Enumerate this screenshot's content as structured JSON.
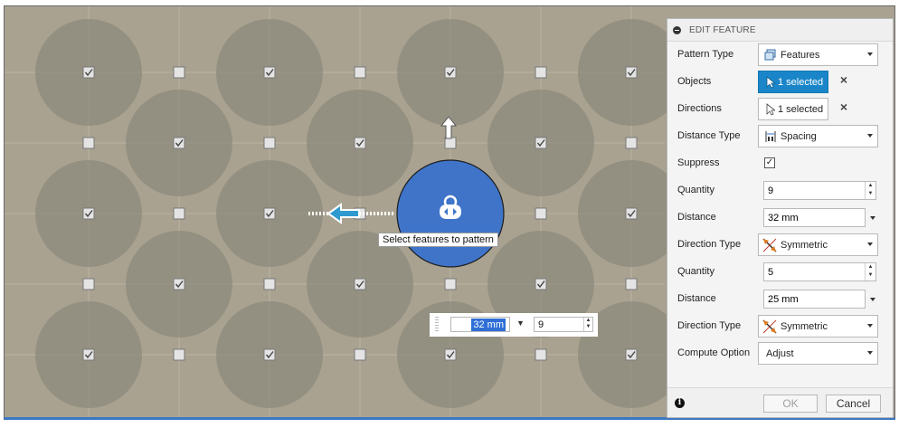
{
  "viewport": {
    "tooltip": "Select features to pattern",
    "inline_distance": "32 mm",
    "inline_quantity": "9"
  },
  "panel": {
    "title": "EDIT FEATURE",
    "rows": {
      "pattern_type": {
        "label": "Pattern Type",
        "value": "Features"
      },
      "objects": {
        "label": "Objects",
        "value": "1 selected"
      },
      "directions": {
        "label": "Directions",
        "value": "1 selected"
      },
      "distance_type": {
        "label": "Distance Type",
        "value": "Spacing"
      },
      "suppress": {
        "label": "Suppress",
        "checked": true
      },
      "quantity1": {
        "label": "Quantity",
        "value": "9"
      },
      "distance1": {
        "label": "Distance",
        "value": "32 mm"
      },
      "direction_type1": {
        "label": "Direction Type",
        "value": "Symmetric"
      },
      "quantity2": {
        "label": "Quantity",
        "value": "5"
      },
      "distance2": {
        "label": "Distance",
        "value": "25 mm"
      },
      "direction_type2": {
        "label": "Direction Type",
        "value": "Symmetric"
      },
      "compute_option": {
        "label": "Compute Option",
        "value": "Adjust"
      }
    },
    "ok_label": "OK",
    "cancel_label": "Cancel"
  },
  "colors": {
    "canvas": "#a9a290",
    "feature_circle": "#8e897c",
    "selected_feature": "#3f74c9",
    "active_select": "#1a86c9",
    "arrow_accent": "#2f9ad0"
  }
}
